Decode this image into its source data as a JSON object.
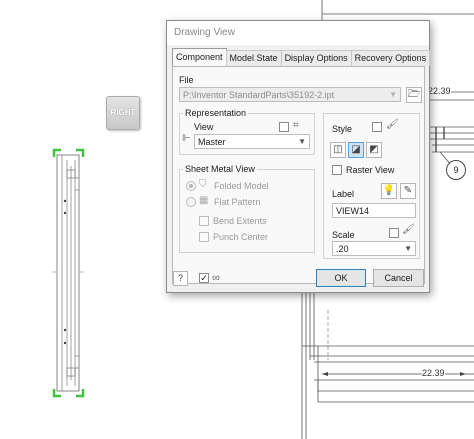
{
  "background": {
    "dimension_top": "22.39",
    "dimension_bottom": "22.39",
    "balloon_number": "9",
    "view_cube_label": "RIGHT"
  },
  "dialog": {
    "title": "Drawing View",
    "tabs": [
      {
        "label": "Component",
        "active": true
      },
      {
        "label": "Model State",
        "active": false
      },
      {
        "label": "Display Options",
        "active": false
      },
      {
        "label": "Recovery Options",
        "active": false
      }
    ],
    "file": {
      "label": "File",
      "value": "P:\\Inventor StandardParts\\35192-2.ipt"
    },
    "representation": {
      "group_title": "Representation",
      "view_label": "View",
      "view_value": "Master"
    },
    "sheet_metal_view": {
      "group_title": "Sheet Metal View",
      "folded_model": "Folded Model",
      "flat_pattern": "Flat Pattern",
      "bend_extents": "Bend Extents",
      "punch_center": "Punch Center"
    },
    "style": {
      "label": "Style",
      "raster_view": "Raster View"
    },
    "view_label": {
      "label": "Label",
      "value": "VIEW14"
    },
    "scale": {
      "label": "Scale",
      "value": ".20"
    },
    "footer": {
      "ok_label": "OK",
      "cancel_label": "Cancel",
      "preview_checked": true
    },
    "colors": {
      "accent": "#5a9fd8",
      "selection_green": "#3cc43c"
    }
  }
}
